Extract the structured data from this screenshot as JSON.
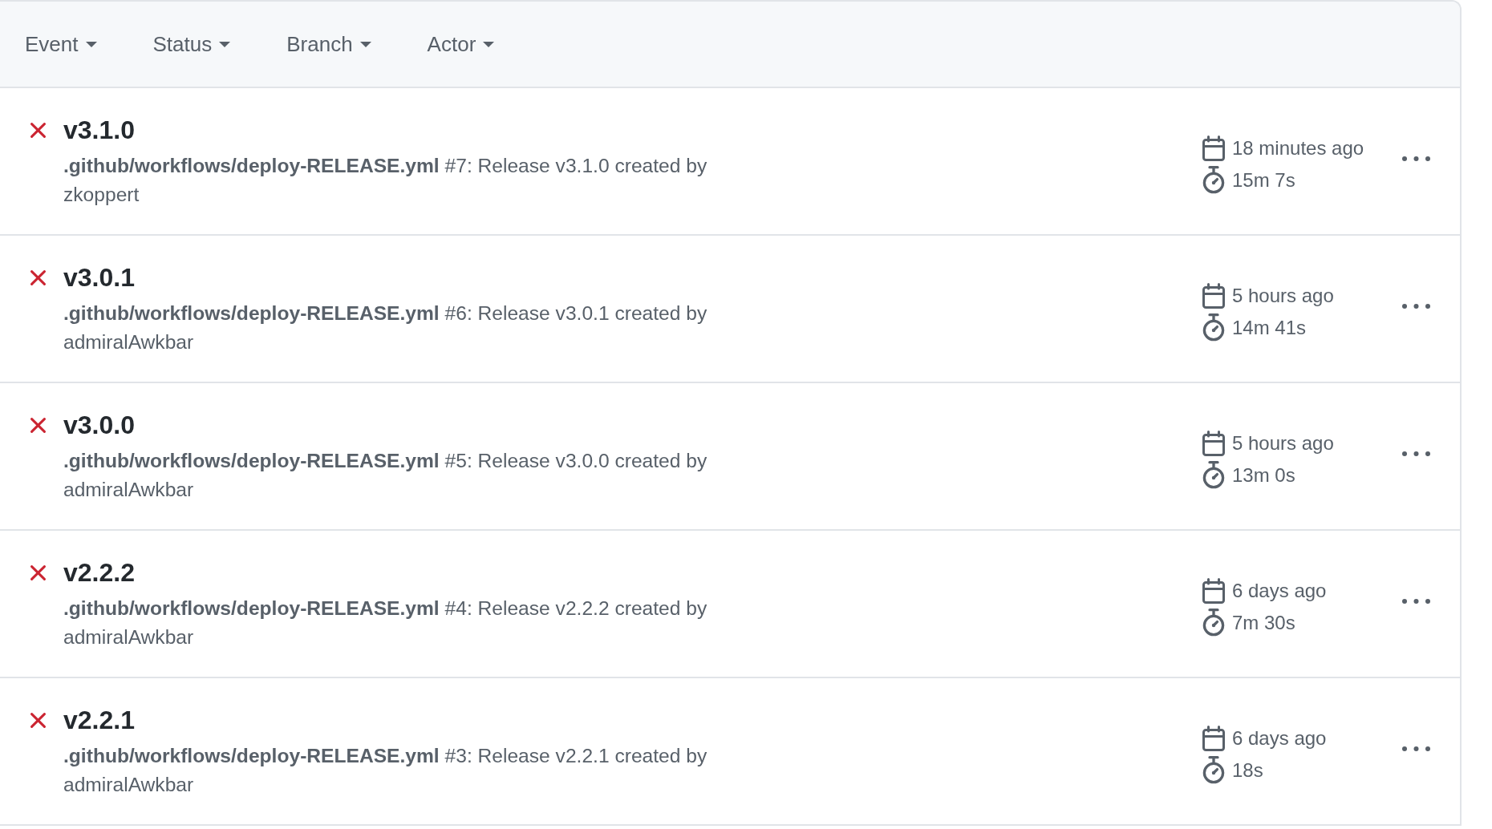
{
  "filters": [
    {
      "label": "Event"
    },
    {
      "label": "Status"
    },
    {
      "label": "Branch"
    },
    {
      "label": "Actor"
    }
  ],
  "runs": [
    {
      "failed": true,
      "title": "v3.1.0",
      "description": "**.github/workflows/deploy-RELEASE.yml** #7: Release v3.1.0 created by zkoppert",
      "date": "18 minutes ago",
      "duration": "15m 7s"
    },
    {
      "failed": true,
      "title": "v3.0.1",
      "description": "**.github/workflows/deploy-RELEASE.yml** #6: Release v3.0.1 created by admiralAwkbar",
      "date": "5 hours ago",
      "duration": "14m 41s"
    },
    {
      "failed": true,
      "title": "v3.0.0",
      "description": "**.github/workflows/deploy-RELEASE.yml** #5: Release v3.0.0 created by admiralAwkbar",
      "date": "5 hours ago",
      "duration": "13m 0s"
    },
    {
      "failed": true,
      "title": "v2.2.2",
      "description": "**.github/workflows/deploy-RELEASE.yml** #4: Release v2.2.2 created by admiralAwkbar",
      "date": "6 days ago",
      "duration": "7m 30s"
    },
    {
      "failed": true,
      "title": "v2.2.1",
      "description": "**.github/workflows/deploy-RELEASE.yml** #3: Release v2.2.1 created by admiralAwkbar",
      "date": "6 days ago",
      "duration": "18s"
    }
  ]
}
